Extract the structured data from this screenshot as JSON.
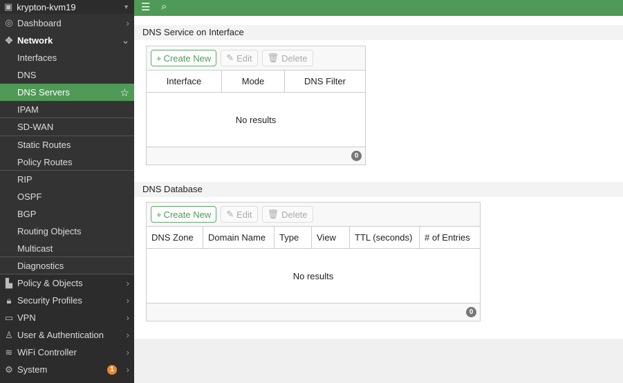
{
  "sidebar": {
    "device": "krypton-kvm19",
    "items": [
      {
        "label": "Dashboard",
        "icon": "dashboard-icon"
      },
      {
        "label": "Network",
        "icon": "network-icon"
      },
      {
        "label": "Interfaces"
      },
      {
        "label": "DNS"
      },
      {
        "label": "DNS Servers"
      },
      {
        "label": "IPAM"
      },
      {
        "label": "SD-WAN"
      },
      {
        "label": "Static Routes"
      },
      {
        "label": "Policy Routes"
      },
      {
        "label": "RIP"
      },
      {
        "label": "OSPF"
      },
      {
        "label": "BGP"
      },
      {
        "label": "Routing Objects"
      },
      {
        "label": "Multicast"
      },
      {
        "label": "Diagnostics"
      },
      {
        "label": "Policy & Objects",
        "icon": "policy-icon"
      },
      {
        "label": "Security Profiles",
        "icon": "lock-icon"
      },
      {
        "label": "VPN",
        "icon": "laptop-icon"
      },
      {
        "label": "User & Authentication",
        "icon": "user-icon"
      },
      {
        "label": "WiFi Controller",
        "icon": "wifi-icon"
      },
      {
        "label": "System",
        "icon": "gear-icon",
        "badge": "1"
      }
    ]
  },
  "sections": [
    {
      "title": "DNS Service on Interface",
      "buttons": {
        "create": "Create New",
        "edit": "Edit",
        "delete": "Delete"
      },
      "columns": [
        "Interface",
        "Mode",
        "DNS Filter"
      ],
      "empty": "No results",
      "count": "0"
    },
    {
      "title": "DNS Database",
      "buttons": {
        "create": "Create New",
        "edit": "Edit",
        "delete": "Delete"
      },
      "columns": [
        "DNS Zone",
        "Domain Name",
        "Type",
        "View",
        "TTL (seconds)",
        "# of Entries"
      ],
      "empty": "No results",
      "count": "0"
    }
  ],
  "colors": {
    "accent": "#4f9a56",
    "sidebar": "#2c2c2c",
    "badge": "#e8892b"
  }
}
